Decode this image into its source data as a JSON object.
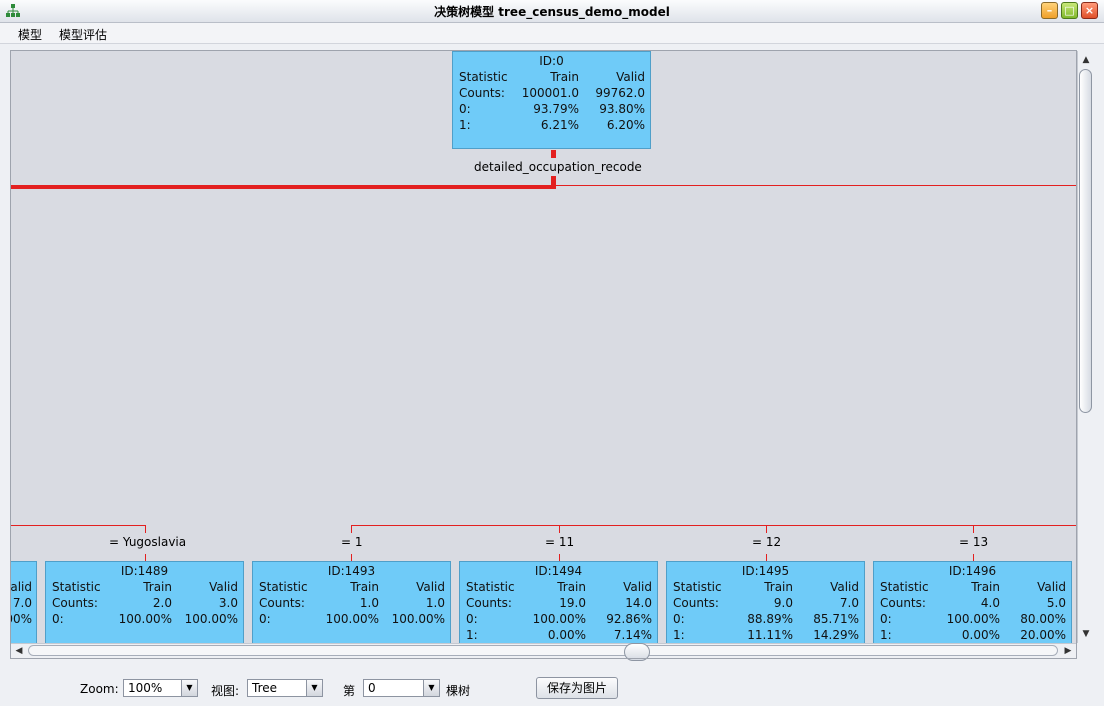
{
  "window": {
    "title": "决策树模型 tree_census_demo_model"
  },
  "menu": {
    "items": [
      "模型",
      "模型评估"
    ]
  },
  "root": {
    "id": "ID:0",
    "headers": [
      "Statistic",
      "Train",
      "Valid"
    ],
    "rows": [
      [
        "Counts:",
        "100001.0",
        "99762.0"
      ],
      [
        "0:",
        "93.79%",
        "93.80%"
      ],
      [
        "1:",
        "6.21%",
        "6.20%"
      ]
    ],
    "split": "detailed_occupation_recode"
  },
  "partial_node": {
    "header": "alid",
    "counts": "7.0",
    "row0": "00%"
  },
  "children": [
    {
      "label": "=  Yugoslavia",
      "id": "ID:1489",
      "headers": [
        "Statistic",
        "Train",
        "Valid"
      ],
      "rows": [
        [
          "Counts:",
          "2.0",
          "3.0"
        ],
        [
          "0:",
          "100.00%",
          "100.00%"
        ]
      ]
    },
    {
      "label": "=  1",
      "id": "ID:1493",
      "headers": [
        "Statistic",
        "Train",
        "Valid"
      ],
      "rows": [
        [
          "Counts:",
          "1.0",
          "1.0"
        ],
        [
          "0:",
          "100.00%",
          "100.00%"
        ]
      ]
    },
    {
      "label": "=  11",
      "id": "ID:1494",
      "headers": [
        "Statistic",
        "Train",
        "Valid"
      ],
      "rows": [
        [
          "Counts:",
          "19.0",
          "14.0"
        ],
        [
          "0:",
          "100.00%",
          "92.86%"
        ],
        [
          "1:",
          "0.00%",
          "7.14%"
        ]
      ]
    },
    {
      "label": "=  12",
      "id": "ID:1495",
      "headers": [
        "Statistic",
        "Train",
        "Valid"
      ],
      "rows": [
        [
          "Counts:",
          "9.0",
          "7.0"
        ],
        [
          "0:",
          "88.89%",
          "85.71%"
        ],
        [
          "1:",
          "11.11%",
          "14.29%"
        ]
      ]
    },
    {
      "label": "=  13",
      "id": "ID:1496",
      "headers": [
        "Statistic",
        "Train",
        "Valid"
      ],
      "rows": [
        [
          "Counts:",
          "4.0",
          "5.0"
        ],
        [
          "0:",
          "100.00%",
          "80.00%"
        ],
        [
          "1:",
          "0.00%",
          "20.00%"
        ]
      ]
    }
  ],
  "controls": {
    "zoom_label": "Zoom:",
    "zoom_value": "100%",
    "view_label": "视图:",
    "view_value": "Tree",
    "index_prefix": "第",
    "index_value": "0",
    "index_suffix": "棵树",
    "save_button": "保存为图片"
  }
}
